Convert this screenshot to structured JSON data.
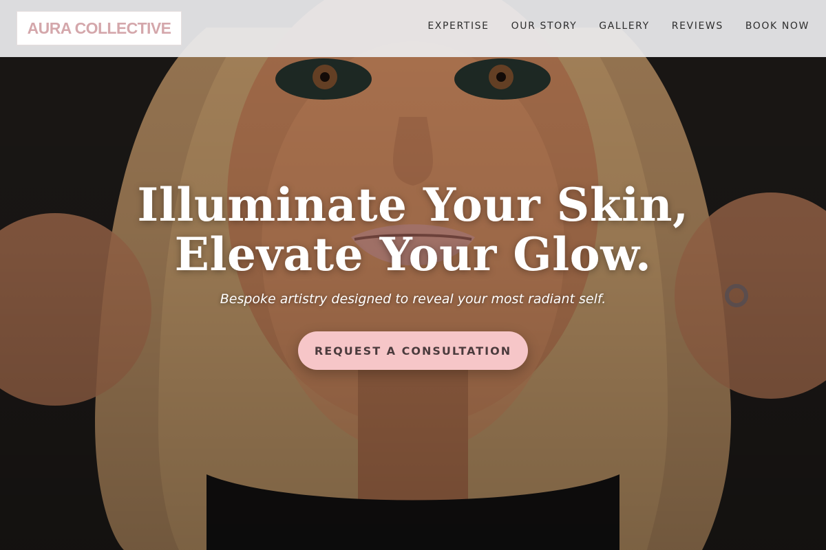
{
  "brand": {
    "logo_text": "AURA COLLECTIVE"
  },
  "nav": {
    "items": [
      {
        "label": "EXPERTISE"
      },
      {
        "label": "OUR STORY"
      },
      {
        "label": "GALLERY"
      },
      {
        "label": "REVIEWS"
      },
      {
        "label": "BOOK NOW"
      }
    ]
  },
  "hero": {
    "headline_line1": "Illuminate Your Skin,",
    "headline_line2": "Elevate Your Glow.",
    "subheadline": "Bespoke artistry designed to reveal your most radiant self.",
    "cta_label": "REQUEST A CONSULTATION",
    "background_image": "portrait-photo"
  },
  "colors": {
    "accent_pink": "#f6c6c8",
    "logo_pink": "#d4a7ab",
    "nav_text": "#2d2d2d",
    "header_bg": "#ececee"
  }
}
